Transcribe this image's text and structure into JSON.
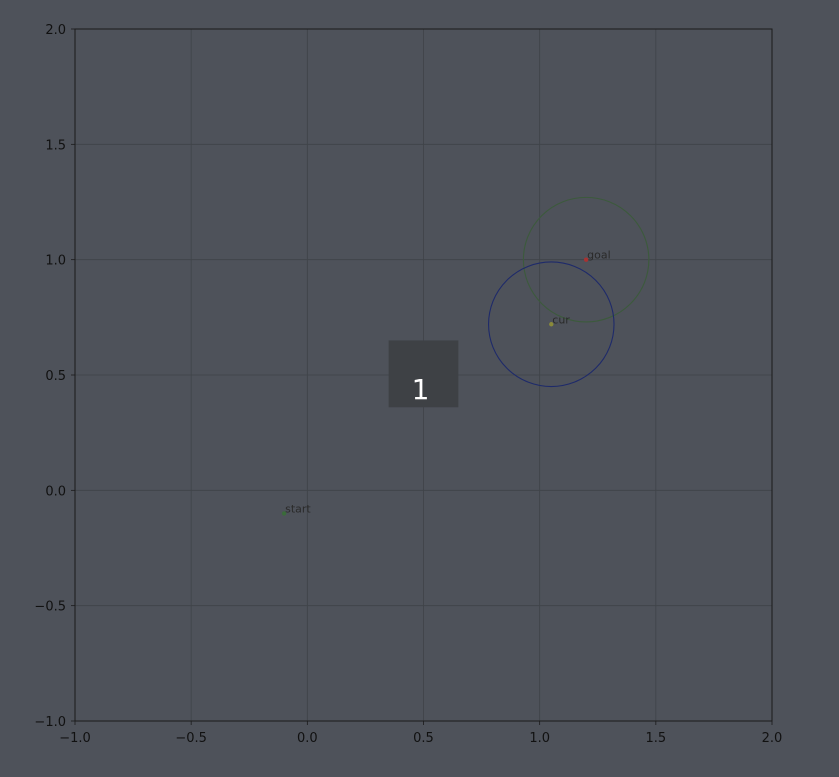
{
  "chart_data": {
    "type": "scatter",
    "title": "",
    "xlabel": "",
    "ylabel": "",
    "xlim": [
      -1.0,
      2.0
    ],
    "ylim": [
      -1.0,
      2.0
    ],
    "grid": true,
    "x_ticks": [
      "−1.0",
      "−0.5",
      "0.0",
      "0.5",
      "1.0",
      "1.5",
      "2.0"
    ],
    "y_ticks": [
      "−1.0",
      "−0.5",
      "0.0",
      "0.5",
      "1.0",
      "1.5",
      "2.0"
    ],
    "points": [
      {
        "label": "start",
        "x": -0.1,
        "y": -0.1,
        "color": "#3a6b3a"
      },
      {
        "label": "goal",
        "x": 1.2,
        "y": 1.0,
        "color": "#a83232"
      },
      {
        "label": "cur",
        "x": 1.05,
        "y": 0.72,
        "color": "#8a8a3a"
      }
    ],
    "circles": [
      {
        "name": "goal-region",
        "cx": 1.2,
        "cy": 1.0,
        "r": 0.27,
        "color": "#3c5a3c"
      },
      {
        "name": "current-region",
        "cx": 1.05,
        "cy": 0.72,
        "r": 0.27,
        "color": "#1e2a6a"
      }
    ],
    "obstacles": [
      {
        "label": "1",
        "x0": 0.35,
        "y0": 0.36,
        "x1": 0.65,
        "y1": 0.65,
        "color": "#3e4145"
      }
    ],
    "colors": {
      "background": "#4e525a",
      "grid": "#3f4348",
      "spine": "#1a1a1a"
    }
  }
}
